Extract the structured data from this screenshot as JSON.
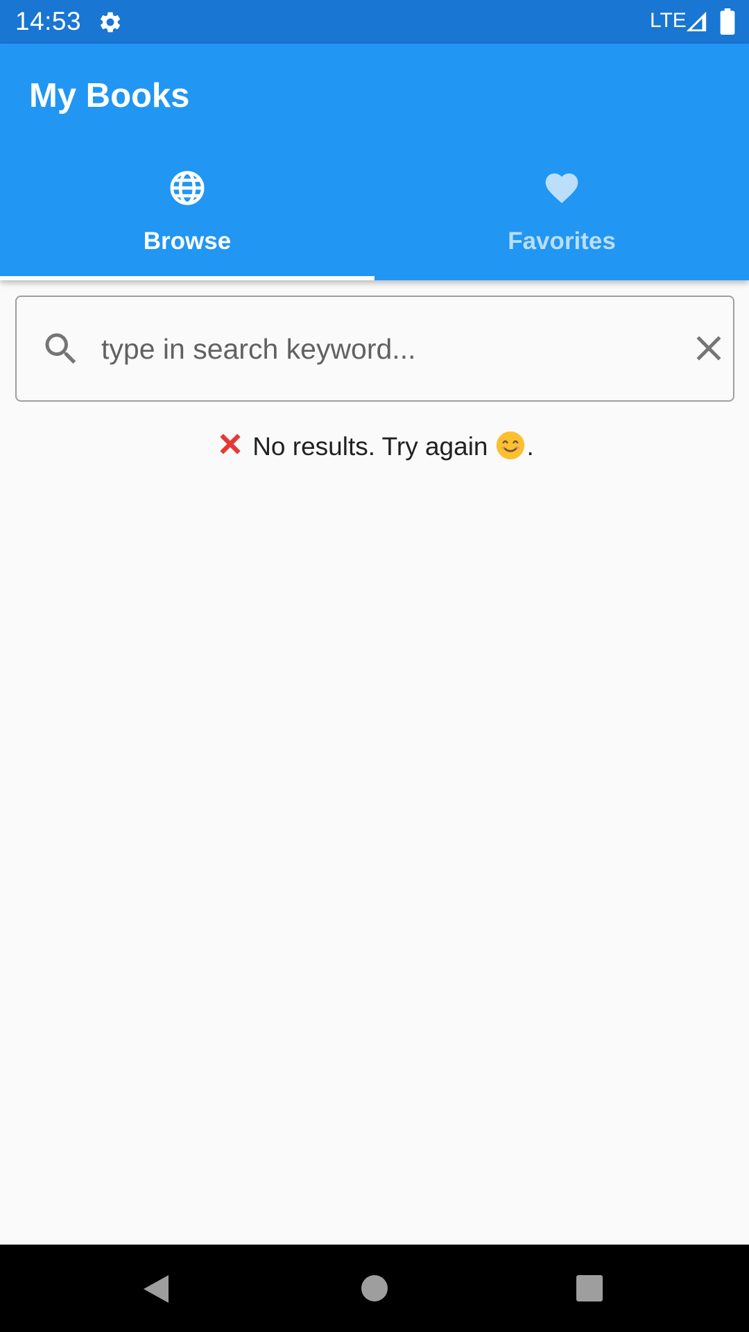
{
  "status_bar": {
    "time": "14:53",
    "network": "LTE"
  },
  "app_bar": {
    "title": "My Books",
    "tabs": [
      {
        "label": "Browse",
        "icon": "globe-icon",
        "selected": true
      },
      {
        "label": "Favorites",
        "icon": "heart-icon",
        "selected": false
      }
    ]
  },
  "search": {
    "value": "",
    "placeholder": "type in search keyword..."
  },
  "results": {
    "empty_text_main": "No results. Try again",
    "empty_text_end": ".",
    "leading_icon": "cross-mark-icon",
    "trailing_icon": "smiling-face-icon"
  },
  "colors": {
    "status_bar": "#1976d2",
    "primary": "#2196f3",
    "inactive_tab": "#bbdefb",
    "background": "#fafafa"
  }
}
